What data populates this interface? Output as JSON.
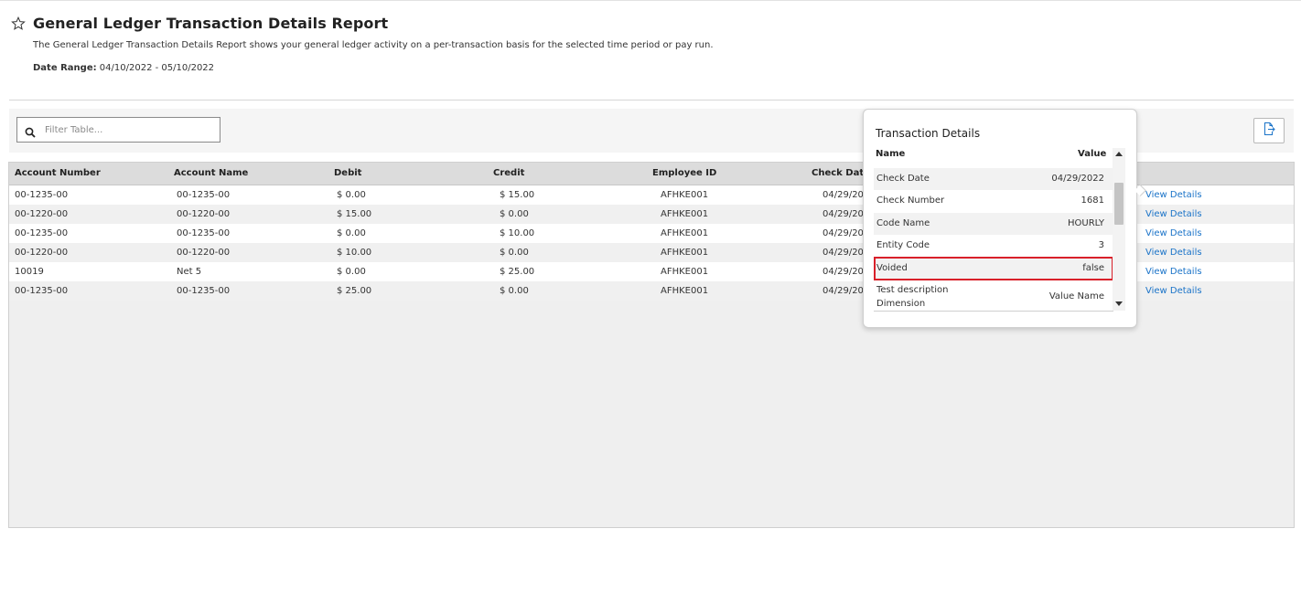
{
  "header": {
    "title": "General Ledger Transaction Details Report",
    "description": "The General Ledger Transaction Details Report shows your general ledger activity on a per-transaction basis for the selected time period or pay run.",
    "date_range_label": "Date Range:",
    "date_range_value": "04/10/2022 - 05/10/2022"
  },
  "toolbar": {
    "filter_placeholder": "Filter Table...",
    "export_icon": "export-icon"
  },
  "table": {
    "columns": [
      "Account Number",
      "Account Name",
      "Debit",
      "Credit",
      "Employee ID",
      "Check Date"
    ],
    "view_details_label": "View Details",
    "rows": [
      {
        "account_number": "00-1235-00",
        "account_name": "00-1235-00",
        "debit": "$ 0.00",
        "credit": "$ 15.00",
        "employee_id": "AFHKE001",
        "check_date": "04/29/2022"
      },
      {
        "account_number": "00-1220-00",
        "account_name": "00-1220-00",
        "debit": "$ 15.00",
        "credit": "$ 0.00",
        "employee_id": "AFHKE001",
        "check_date": "04/29/2022"
      },
      {
        "account_number": "00-1235-00",
        "account_name": "00-1235-00",
        "debit": "$ 0.00",
        "credit": "$ 10.00",
        "employee_id": "AFHKE001",
        "check_date": "04/29/2022"
      },
      {
        "account_number": "00-1220-00",
        "account_name": "00-1220-00",
        "debit": "$ 10.00",
        "credit": "$ 0.00",
        "employee_id": "AFHKE001",
        "check_date": "04/29/2022"
      },
      {
        "account_number": "10019",
        "account_name": "Net 5",
        "debit": "$ 0.00",
        "credit": "$ 25.00",
        "employee_id": "AFHKE001",
        "check_date": "04/29/2022"
      },
      {
        "account_number": "00-1235-00",
        "account_name": "00-1235-00",
        "debit": "$ 25.00",
        "credit": "$ 0.00",
        "employee_id": "AFHKE001",
        "check_date": "04/29/2022"
      }
    ]
  },
  "popover": {
    "title": "Transaction Details",
    "name_header": "Name",
    "value_header": "Value",
    "items": [
      {
        "name": "Check Date",
        "value": "04/29/2022"
      },
      {
        "name": "Check Number",
        "value": "1681"
      },
      {
        "name": "Code Name",
        "value": "HOURLY"
      },
      {
        "name": "Entity Code",
        "value": "3"
      },
      {
        "name": "Voided",
        "value": "false"
      },
      {
        "name": "Test description Dimension",
        "value": "Value Name"
      }
    ]
  },
  "colors": {
    "link": "#1a73c8",
    "highlight": "#d9202a"
  }
}
